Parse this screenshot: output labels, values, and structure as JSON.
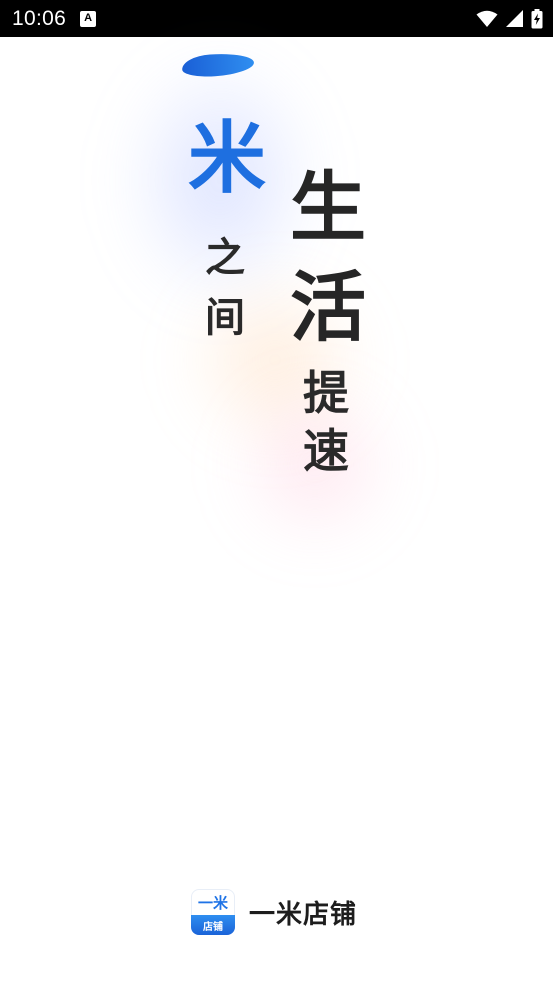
{
  "status_bar": {
    "time": "10:06",
    "notification_icon": "a-icon",
    "icons": [
      "wifi-icon",
      "signal-icon",
      "battery-charging-icon"
    ]
  },
  "splash": {
    "calligraphy": {
      "left_column": [
        "一",
        "米",
        "之",
        "间"
      ],
      "right_column": [
        "生",
        "活",
        "提",
        "速"
      ]
    },
    "accent_color": "#1e6fe0"
  },
  "brand": {
    "logo_top": "一米",
    "logo_bottom": "店铺",
    "name": "一米店铺"
  }
}
